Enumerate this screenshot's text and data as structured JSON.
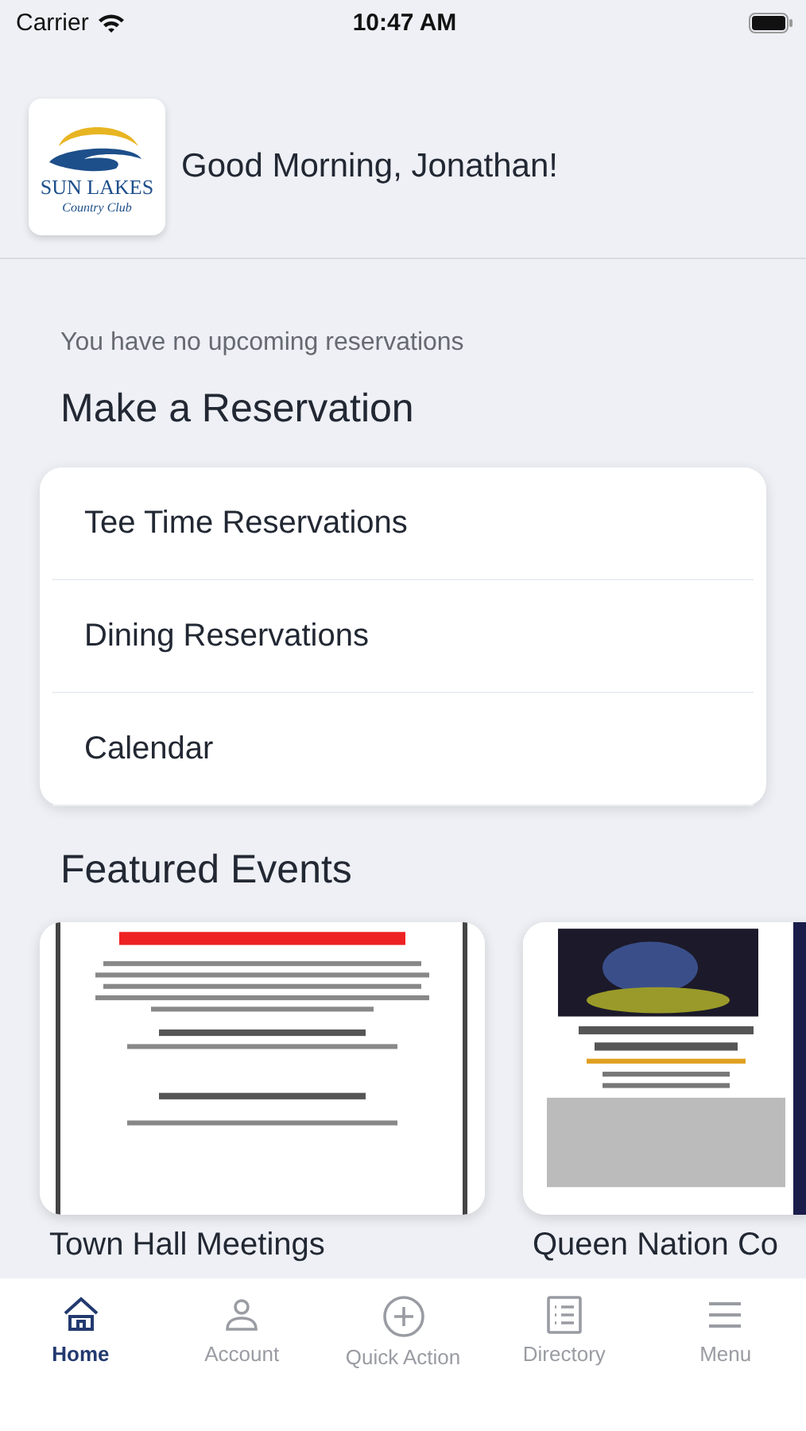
{
  "status_bar": {
    "carrier": "Carrier",
    "time": "10:47 AM"
  },
  "header": {
    "logo_name": "SUN LAKES",
    "logo_sub": "Country Club",
    "greeting": "Good Morning, Jonathan!"
  },
  "notice": "You have no upcoming reservations",
  "reservations": {
    "title": "Make a Reservation",
    "items": [
      {
        "label": "Tee Time Reservations"
      },
      {
        "label": "Dining Reservations"
      },
      {
        "label": "Calendar"
      }
    ]
  },
  "featured": {
    "title": "Featured Events",
    "events": [
      {
        "title": "Town Hall Meetings"
      },
      {
        "title": "Queen Nation Co"
      }
    ]
  },
  "tab_bar": [
    {
      "label": "Home",
      "kind": "home",
      "selected": true
    },
    {
      "label": "Account",
      "kind": "person",
      "selected": false
    },
    {
      "label": "Quick Action",
      "kind": "plus",
      "selected": false
    },
    {
      "label": "Directory",
      "kind": "list",
      "selected": false
    },
    {
      "label": "Menu",
      "kind": "menu",
      "selected": false
    }
  ]
}
